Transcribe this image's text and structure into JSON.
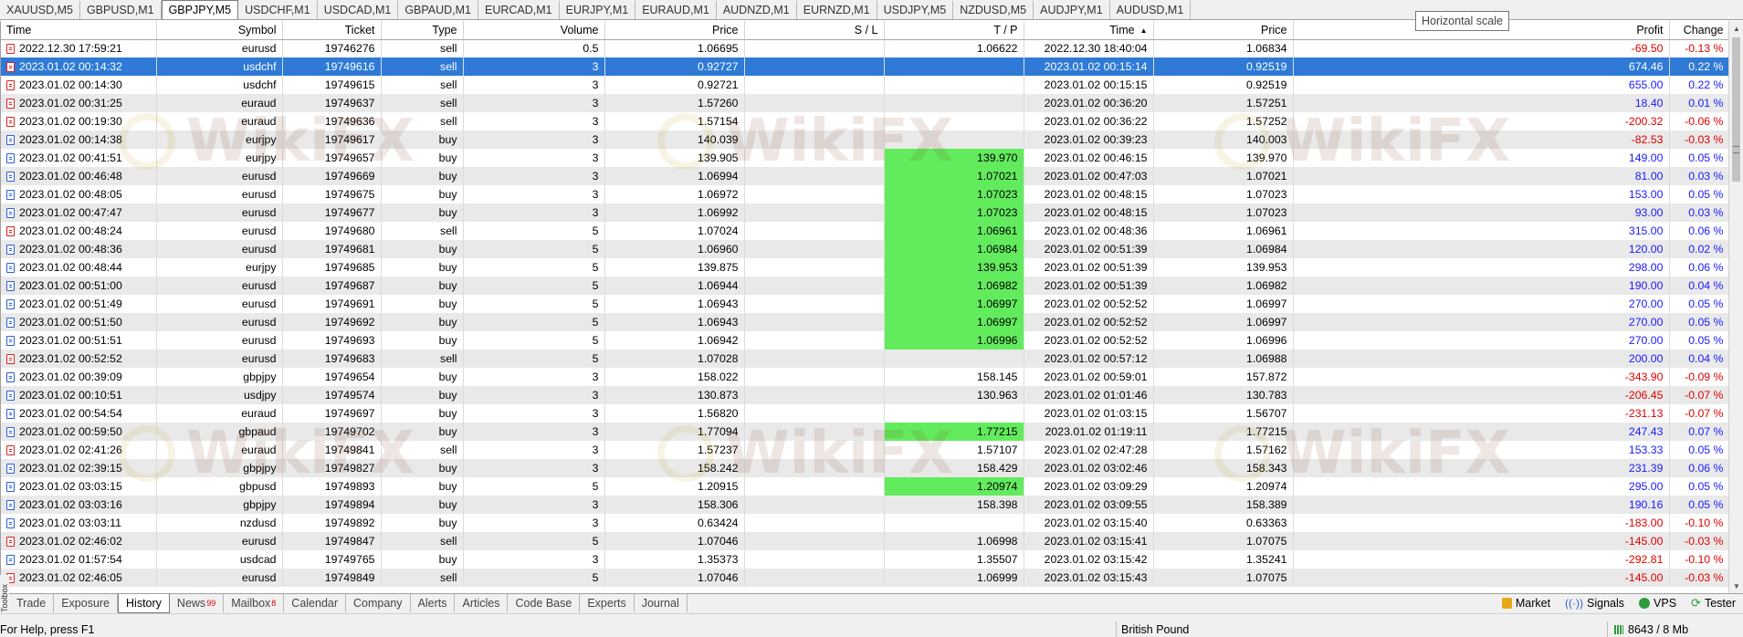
{
  "chart_tabs": [
    "XAUUSD,M5",
    "GBPUSD,M1",
    "GBPJPY,M5",
    "USDCHF,M1",
    "USDCAD,M1",
    "GBPAUD,M1",
    "EURCAD,M1",
    "EURJPY,M1",
    "EURAUD,M1",
    "AUDNZD,M1",
    "EURNZD,M1",
    "USDJPY,M5",
    "NZDUSD,M5",
    "AUDJPY,M1",
    "AUDUSD,M1"
  ],
  "active_chart_tab": 2,
  "tooltip": "Horizontal scale",
  "columns": {
    "open_time": "Time",
    "symbol": "Symbol",
    "ticket": "Ticket",
    "type": "Type",
    "volume": "Volume",
    "open_price": "Price",
    "sl": "S / L",
    "tp": "T / P",
    "close_time": "Time",
    "close_price": "Price",
    "profit": "Profit",
    "change": "Change"
  },
  "rows": [
    {
      "ot": "2022.12.30 17:59:21",
      "sym": "eurusd",
      "tk": "19746276",
      "type": "sell",
      "vol": "0.5",
      "op": "1.06695",
      "sl": "",
      "tp": "1.06622",
      "tp_hit": false,
      "ct": "2022.12.30 18:40:04",
      "cp": "1.06834",
      "pf": "-69.50",
      "ch": "-0.13 %"
    },
    {
      "ot": "2023.01.02 00:14:32",
      "sym": "usdchf",
      "tk": "19749616",
      "type": "sell",
      "vol": "3",
      "op": "0.92727",
      "sl": "",
      "tp": "",
      "tp_hit": false,
      "ct": "2023.01.02 00:15:14",
      "cp": "0.92519",
      "pf": "674.46",
      "ch": "0.22 %",
      "selected": true
    },
    {
      "ot": "2023.01.02 00:14:30",
      "sym": "usdchf",
      "tk": "19749615",
      "type": "sell",
      "vol": "3",
      "op": "0.92721",
      "sl": "",
      "tp": "",
      "tp_hit": false,
      "ct": "2023.01.02 00:15:15",
      "cp": "0.92519",
      "pf": "655.00",
      "ch": "0.22 %"
    },
    {
      "ot": "2023.01.02 00:31:25",
      "sym": "euraud",
      "tk": "19749637",
      "type": "sell",
      "vol": "3",
      "op": "1.57260",
      "sl": "",
      "tp": "",
      "tp_hit": false,
      "ct": "2023.01.02 00:36:20",
      "cp": "1.57251",
      "pf": "18.40",
      "ch": "0.01 %"
    },
    {
      "ot": "2023.01.02 00:19:30",
      "sym": "euraud",
      "tk": "19749636",
      "type": "sell",
      "vol": "3",
      "op": "1.57154",
      "sl": "",
      "tp": "",
      "tp_hit": false,
      "ct": "2023.01.02 00:36:22",
      "cp": "1.57252",
      "pf": "-200.32",
      "ch": "-0.06 %"
    },
    {
      "ot": "2023.01.02 00:14:38",
      "sym": "eurjpy",
      "tk": "19749617",
      "type": "buy",
      "vol": "3",
      "op": "140.039",
      "sl": "",
      "tp": "",
      "tp_hit": false,
      "ct": "2023.01.02 00:39:23",
      "cp": "140.003",
      "pf": "-82.53",
      "ch": "-0.03 %"
    },
    {
      "ot": "2023.01.02 00:41:51",
      "sym": "eurjpy",
      "tk": "19749657",
      "type": "buy",
      "vol": "3",
      "op": "139.905",
      "sl": "",
      "tp": "139.970",
      "tp_hit": true,
      "ct": "2023.01.02 00:46:15",
      "cp": "139.970",
      "pf": "149.00",
      "ch": "0.05 %"
    },
    {
      "ot": "2023.01.02 00:46:48",
      "sym": "eurusd",
      "tk": "19749669",
      "type": "buy",
      "vol": "3",
      "op": "1.06994",
      "sl": "",
      "tp": "1.07021",
      "tp_hit": true,
      "ct": "2023.01.02 00:47:03",
      "cp": "1.07021",
      "pf": "81.00",
      "ch": "0.03 %"
    },
    {
      "ot": "2023.01.02 00:48:05",
      "sym": "eurusd",
      "tk": "19749675",
      "type": "buy",
      "vol": "3",
      "op": "1.06972",
      "sl": "",
      "tp": "1.07023",
      "tp_hit": true,
      "ct": "2023.01.02 00:48:15",
      "cp": "1.07023",
      "pf": "153.00",
      "ch": "0.05 %"
    },
    {
      "ot": "2023.01.02 00:47:47",
      "sym": "eurusd",
      "tk": "19749677",
      "type": "buy",
      "vol": "3",
      "op": "1.06992",
      "sl": "",
      "tp": "1.07023",
      "tp_hit": true,
      "ct": "2023.01.02 00:48:15",
      "cp": "1.07023",
      "pf": "93.00",
      "ch": "0.03 %"
    },
    {
      "ot": "2023.01.02 00:48:24",
      "sym": "eurusd",
      "tk": "19749680",
      "type": "sell",
      "vol": "5",
      "op": "1.07024",
      "sl": "",
      "tp": "1.06961",
      "tp_hit": true,
      "ct": "2023.01.02 00:48:36",
      "cp": "1.06961",
      "pf": "315.00",
      "ch": "0.06 %"
    },
    {
      "ot": "2023.01.02 00:48:36",
      "sym": "eurusd",
      "tk": "19749681",
      "type": "buy",
      "vol": "5",
      "op": "1.06960",
      "sl": "",
      "tp": "1.06984",
      "tp_hit": true,
      "ct": "2023.01.02 00:51:39",
      "cp": "1.06984",
      "pf": "120.00",
      "ch": "0.02 %"
    },
    {
      "ot": "2023.01.02 00:48:44",
      "sym": "eurjpy",
      "tk": "19749685",
      "type": "buy",
      "vol": "5",
      "op": "139.875",
      "sl": "",
      "tp": "139.953",
      "tp_hit": true,
      "ct": "2023.01.02 00:51:39",
      "cp": "139.953",
      "pf": "298.00",
      "ch": "0.06 %"
    },
    {
      "ot": "2023.01.02 00:51:00",
      "sym": "eurusd",
      "tk": "19749687",
      "type": "buy",
      "vol": "5",
      "op": "1.06944",
      "sl": "",
      "tp": "1.06982",
      "tp_hit": true,
      "ct": "2023.01.02 00:51:39",
      "cp": "1.06982",
      "pf": "190.00",
      "ch": "0.04 %"
    },
    {
      "ot": "2023.01.02 00:51:49",
      "sym": "eurusd",
      "tk": "19749691",
      "type": "buy",
      "vol": "5",
      "op": "1.06943",
      "sl": "",
      "tp": "1.06997",
      "tp_hit": true,
      "ct": "2023.01.02 00:52:52",
      "cp": "1.06997",
      "pf": "270.00",
      "ch": "0.05 %"
    },
    {
      "ot": "2023.01.02 00:51:50",
      "sym": "eurusd",
      "tk": "19749692",
      "type": "buy",
      "vol": "5",
      "op": "1.06943",
      "sl": "",
      "tp": "1.06997",
      "tp_hit": true,
      "ct": "2023.01.02 00:52:52",
      "cp": "1.06997",
      "pf": "270.00",
      "ch": "0.05 %"
    },
    {
      "ot": "2023.01.02 00:51:51",
      "sym": "eurusd",
      "tk": "19749693",
      "type": "buy",
      "vol": "5",
      "op": "1.06942",
      "sl": "",
      "tp": "1.06996",
      "tp_hit": true,
      "ct": "2023.01.02 00:52:52",
      "cp": "1.06996",
      "pf": "270.00",
      "ch": "0.05 %"
    },
    {
      "ot": "2023.01.02 00:52:52",
      "sym": "eurusd",
      "tk": "19749683",
      "type": "sell",
      "vol": "5",
      "op": "1.07028",
      "sl": "",
      "tp": "",
      "tp_hit": false,
      "ct": "2023.01.02 00:57:12",
      "cp": "1.06988",
      "pf": "200.00",
      "ch": "0.04 %"
    },
    {
      "ot": "2023.01.02 00:39:09",
      "sym": "gbpjpy",
      "tk": "19749654",
      "type": "buy",
      "vol": "3",
      "op": "158.022",
      "sl": "",
      "tp": "158.145",
      "tp_hit": false,
      "ct": "2023.01.02 00:59:01",
      "cp": "157.872",
      "pf": "-343.90",
      "ch": "-0.09 %"
    },
    {
      "ot": "2023.01.02 00:10:51",
      "sym": "usdjpy",
      "tk": "19749574",
      "type": "buy",
      "vol": "3",
      "op": "130.873",
      "sl": "",
      "tp": "130.963",
      "tp_hit": false,
      "ct": "2023.01.02 01:01:46",
      "cp": "130.783",
      "pf": "-206.45",
      "ch": "-0.07 %"
    },
    {
      "ot": "2023.01.02 00:54:54",
      "sym": "euraud",
      "tk": "19749697",
      "type": "buy",
      "vol": "3",
      "op": "1.56820",
      "sl": "",
      "tp": "",
      "tp_hit": false,
      "ct": "2023.01.02 01:03:15",
      "cp": "1.56707",
      "pf": "-231.13",
      "ch": "-0.07 %"
    },
    {
      "ot": "2023.01.02 00:59:50",
      "sym": "gbpaud",
      "tk": "19749702",
      "type": "buy",
      "vol": "3",
      "op": "1.77094",
      "sl": "",
      "tp": "1.77215",
      "tp_hit": true,
      "ct": "2023.01.02 01:19:11",
      "cp": "1.77215",
      "pf": "247.43",
      "ch": "0.07 %"
    },
    {
      "ot": "2023.01.02 02:41:26",
      "sym": "euraud",
      "tk": "19749841",
      "type": "sell",
      "vol": "3",
      "op": "1.57237",
      "sl": "",
      "tp": "1.57107",
      "tp_hit": false,
      "ct": "2023.01.02 02:47:28",
      "cp": "1.57162",
      "pf": "153.33",
      "ch": "0.05 %"
    },
    {
      "ot": "2023.01.02 02:39:15",
      "sym": "gbpjpy",
      "tk": "19749827",
      "type": "buy",
      "vol": "3",
      "op": "158.242",
      "sl": "",
      "tp": "158.429",
      "tp_hit": false,
      "ct": "2023.01.02 03:02:46",
      "cp": "158.343",
      "pf": "231.39",
      "ch": "0.06 %"
    },
    {
      "ot": "2023.01.02 03:03:15",
      "sym": "gbpusd",
      "tk": "19749893",
      "type": "buy",
      "vol": "5",
      "op": "1.20915",
      "sl": "",
      "tp": "1.20974",
      "tp_hit": true,
      "ct": "2023.01.02 03:09:29",
      "cp": "1.20974",
      "pf": "295.00",
      "ch": "0.05 %"
    },
    {
      "ot": "2023.01.02 03:03:16",
      "sym": "gbpjpy",
      "tk": "19749894",
      "type": "buy",
      "vol": "3",
      "op": "158.306",
      "sl": "",
      "tp": "158.398",
      "tp_hit": false,
      "ct": "2023.01.02 03:09:55",
      "cp": "158.389",
      "pf": "190.16",
      "ch": "0.05 %"
    },
    {
      "ot": "2023.01.02 03:03:11",
      "sym": "nzdusd",
      "tk": "19749892",
      "type": "buy",
      "vol": "3",
      "op": "0.63424",
      "sl": "",
      "tp": "",
      "tp_hit": false,
      "ct": "2023.01.02 03:15:40",
      "cp": "0.63363",
      "pf": "-183.00",
      "ch": "-0.10 %"
    },
    {
      "ot": "2023.01.02 02:46:02",
      "sym": "eurusd",
      "tk": "19749847",
      "type": "sell",
      "vol": "5",
      "op": "1.07046",
      "sl": "",
      "tp": "1.06998",
      "tp_hit": false,
      "ct": "2023.01.02 03:15:41",
      "cp": "1.07075",
      "pf": "-145.00",
      "ch": "-0.03 %"
    },
    {
      "ot": "2023.01.02 01:57:54",
      "sym": "usdcad",
      "tk": "19749765",
      "type": "buy",
      "vol": "3",
      "op": "1.35373",
      "sl": "",
      "tp": "1.35507",
      "tp_hit": false,
      "ct": "2023.01.02 03:15:42",
      "cp": "1.35241",
      "pf": "-292.81",
      "ch": "-0.10 %"
    },
    {
      "ot": "2023.01.02 02:46:05",
      "sym": "eurusd",
      "tk": "19749849",
      "type": "sell",
      "vol": "5",
      "op": "1.07046",
      "sl": "",
      "tp": "1.06999",
      "tp_hit": false,
      "ct": "2023.01.02 03:15:43",
      "cp": "1.07075",
      "pf": "-145.00",
      "ch": "-0.03 %"
    }
  ],
  "watermark_text": "WikiFX",
  "bottom_tabs": [
    {
      "label": "Trade"
    },
    {
      "label": "Exposure"
    },
    {
      "label": "History",
      "active": true
    },
    {
      "label": "News",
      "badge": "99"
    },
    {
      "label": "Mailbox",
      "badge": "8"
    },
    {
      "label": "Calendar"
    },
    {
      "label": "Company"
    },
    {
      "label": "Alerts"
    },
    {
      "label": "Articles"
    },
    {
      "label": "Code Base"
    },
    {
      "label": "Experts"
    },
    {
      "label": "Journal"
    }
  ],
  "right_tools": {
    "market": "Market",
    "signals": "Signals",
    "vps": "VPS",
    "tester": "Tester"
  },
  "toolbox_label": "Toolbox",
  "status": {
    "help": "For Help, press F1",
    "currency": "British Pound",
    "memory": "8643 / 8 Mb"
  },
  "colors": {
    "selected": "#2e7ad6",
    "tp_hit": "#63eb5e",
    "negative": "#e00000",
    "positive": "#1a1aff",
    "stripe": "#e9e9e9"
  }
}
